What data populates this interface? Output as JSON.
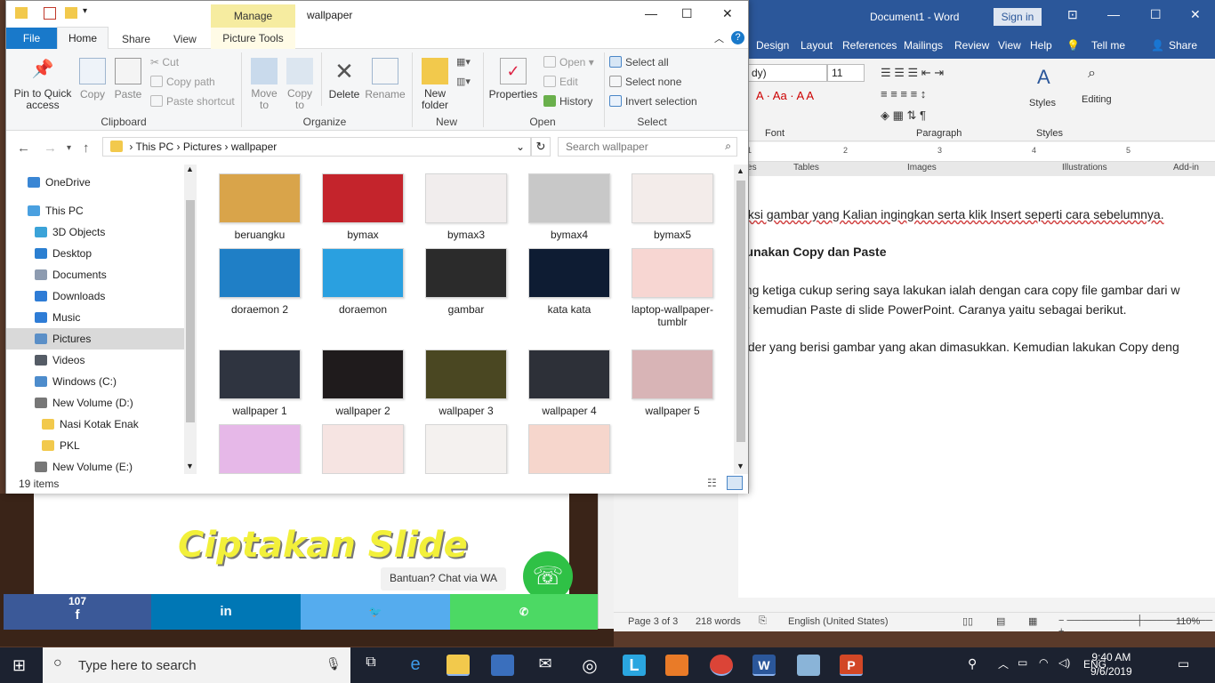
{
  "background": {
    "slide_logo": "Ciptakan Slide",
    "chat_label": "Bantuan? Chat via WA",
    "fb_count": "107"
  },
  "word": {
    "doc_title": "Document1 - Word",
    "sign_in": "Sign in",
    "menu": [
      "Design",
      "Layout",
      "References",
      "Mailings",
      "Review",
      "View",
      "Help",
      "Tell me",
      "Share"
    ],
    "font_name": "dy)",
    "font_size": "11",
    "group_labels": {
      "font": "Font",
      "paragraph": "Paragraph",
      "styles": "Styles"
    },
    "styles_label": "Styles",
    "editing_label": "Editing",
    "panel_tabs": [
      "lides",
      "Tables",
      "Images",
      "Illustrations",
      "Add-in"
    ],
    "ruler_marks": [
      "1",
      "2",
      "3",
      "4",
      "5"
    ],
    "body_lines": [
      "leksi gambar yang Kalian ingingkan serta klik Insert seperti cara sebelumnya.",
      "gunakan Copy dan Paste",
      "ang ketiga cukup sering saya lakukan ialah dengan cara copy file gambar dari w",
      "er kemudian Paste di slide PowerPoint. Caranya yaitu sebagai berikut.",
      "older yang berisi gambar yang akan dimasukkan. Kemudian lakukan Copy deng"
    ],
    "status": {
      "page": "Page 3 of 3",
      "words": "218 words",
      "language": "English (United States)",
      "zoom": "110%"
    }
  },
  "explorer": {
    "manage": "Manage",
    "title": "wallpaper",
    "tabs": {
      "file": "File",
      "home": "Home",
      "share": "Share",
      "view": "View",
      "picture_tools": "Picture Tools"
    },
    "ribbon": {
      "pin": "Pin to Quick access",
      "copy": "Copy",
      "paste": "Paste",
      "cut": "Cut",
      "copy_path": "Copy path",
      "paste_shortcut": "Paste shortcut",
      "clipboard": "Clipboard",
      "move_to": "Move to",
      "copy_to": "Copy to",
      "delete": "Delete",
      "rename": "Rename",
      "organize": "Organize",
      "new_folder": "New folder",
      "new": "New",
      "properties": "Properties",
      "open": "Open",
      "edit": "Edit",
      "history": "History",
      "open_group": "Open",
      "select_all": "Select all",
      "select_none": "Select none",
      "invert_selection": "Invert selection",
      "select_group": "Select"
    },
    "address": {
      "this_pc": "This PC",
      "pictures": "Pictures",
      "folder": "wallpaper"
    },
    "search_placeholder": "Search wallpaper",
    "nav": [
      {
        "label": "OneDrive",
        "color": "#3a86d4"
      },
      {
        "label": "This PC",
        "color": "#4aa0e0"
      },
      {
        "label": "3D Objects",
        "color": "#3ba3d8"
      },
      {
        "label": "Desktop",
        "color": "#2b7fd1"
      },
      {
        "label": "Documents",
        "color": "#8d9bb0"
      },
      {
        "label": "Downloads",
        "color": "#2e7cd6"
      },
      {
        "label": "Music",
        "color": "#2e7cd6"
      },
      {
        "label": "Pictures",
        "color": "#5b8fc7"
      },
      {
        "label": "Videos",
        "color": "#555c66"
      },
      {
        "label": "Windows (C:)",
        "color": "#4d8ccc"
      },
      {
        "label": "New Volume (D:)",
        "color": "#777"
      },
      {
        "label": "Nasi Kotak Enak",
        "color": "#f2c94c"
      },
      {
        "label": "PKL",
        "color": "#f2c94c"
      },
      {
        "label": "New Volume (E:)",
        "color": "#777"
      }
    ],
    "files": [
      {
        "name": "beruangku",
        "color": "#d9a44a"
      },
      {
        "name": "bymax",
        "color": "#c4242c"
      },
      {
        "name": "bymax3",
        "color": "#f1eded"
      },
      {
        "name": "bymax4",
        "color": "#c8c8c8"
      },
      {
        "name": "bymax5",
        "color": "#f3ecea"
      },
      {
        "name": "doraemon 2",
        "color": "#1f7fc6"
      },
      {
        "name": "doraemon",
        "color": "#2aa0e0"
      },
      {
        "name": "gambar",
        "color": "#2b2b2b"
      },
      {
        "name": "kata kata",
        "color": "#0e1c33"
      },
      {
        "name": "laptop-wallpaper-tumblr",
        "color": "#f7d6d2"
      },
      {
        "name": "wallpaper 1",
        "color": "#2f3440"
      },
      {
        "name": "wallpaper 2",
        "color": "#1f1b1c"
      },
      {
        "name": "wallpaper 3",
        "color": "#4a4722"
      },
      {
        "name": "wallpaper 4",
        "color": "#2d3038"
      },
      {
        "name": "wallpaper 5",
        "color": "#d8b4b6"
      },
      {
        "name": "",
        "color": "#e6b8e8"
      },
      {
        "name": "",
        "color": "#f6e4e2"
      },
      {
        "name": "",
        "color": "#f4f1ef"
      },
      {
        "name": "",
        "color": "#f6d6cc"
      }
    ],
    "status": "19 items"
  },
  "taskbar": {
    "search_text": "Type here to search",
    "lang": "ENG",
    "time": "9:40 AM",
    "date": "9/6/2019"
  }
}
